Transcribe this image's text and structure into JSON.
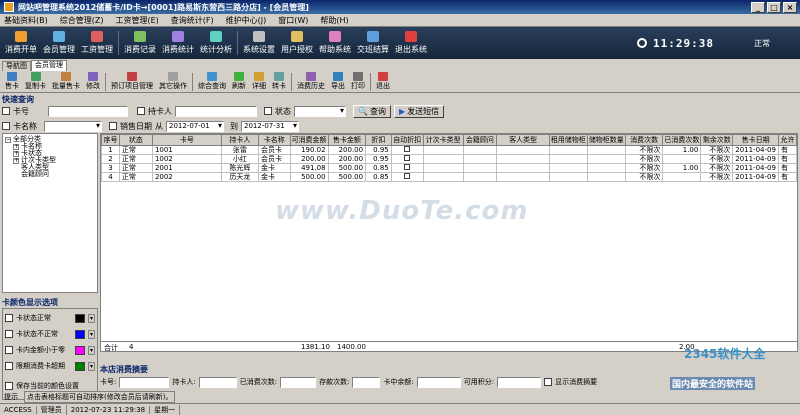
{
  "window": {
    "title": "网站吧管理系统2012储蓄卡/ID卡→[0001]路易斯东营西三路分店] - [会员管理]",
    "buttons": [
      "_",
      "□",
      "×"
    ]
  },
  "menu": [
    "基础资料(B)",
    "综合管理(Z)",
    "工资管理(E)",
    "查询统计(F)",
    "维护中心(J)",
    "窗口(W)",
    "帮助(H)"
  ],
  "main_toolbar": {
    "items": [
      {
        "label": "消费开单",
        "color": "#f0a030"
      },
      {
        "label": "会员管理",
        "color": "#60b0e0"
      },
      {
        "label": "工资管理",
        "color": "#e06060"
      },
      {
        "label": "消费记录",
        "color": "#80c060"
      },
      {
        "label": "消费统计",
        "color": "#a080e0"
      },
      {
        "label": "统计分析",
        "color": "#60d0c0"
      },
      {
        "label": "系统设置",
        "color": "#c0c0c0"
      },
      {
        "label": "用户授权",
        "color": "#e0c060"
      },
      {
        "label": "帮助系统",
        "color": "#e080c0"
      },
      {
        "label": "交班结算",
        "color": "#60a0e0"
      },
      {
        "label": "退出系统",
        "color": "#e04040"
      }
    ],
    "time": "11:29:38",
    "status": "正常"
  },
  "tabs": [
    {
      "label": "导航图",
      "active": false
    },
    {
      "label": "会员管理",
      "active": true
    }
  ],
  "sub_toolbar": {
    "items": [
      "售卡",
      "复制卡",
      "批量售卡",
      "修改",
      "预订项目管理",
      "其它操作",
      "综合查询",
      "刷新",
      "详细",
      "转卡",
      "消费历史",
      "导出",
      "打印",
      "退出"
    ]
  },
  "quick_query": {
    "title": "快速查询",
    "card_no_label": "卡号",
    "holder_label": "持卡人",
    "state_label": "状态",
    "query_button": "查询",
    "sms_button": "发送短信",
    "card_name_label": "卡名称",
    "sell_date_label": "销售日期",
    "from_label": "从",
    "from_date": "2012-07-01",
    "to_label": "到",
    "to_date": "2012-07-31"
  },
  "tree": {
    "root": "全部分类",
    "children": [
      {
        "label": "卡名称",
        "expander": "+"
      },
      {
        "label": "卡状态",
        "expander": "+"
      },
      {
        "label": "计次卡类型",
        "expander": "+"
      },
      {
        "label": "客人类型",
        "expander": ""
      },
      {
        "label": "会籍顾问",
        "expander": ""
      }
    ]
  },
  "color_options": {
    "title": "卡颜色显示选项",
    "rows": [
      {
        "label": "卡状态正常",
        "color": "#000000"
      },
      {
        "label": "卡状态不正常",
        "color": "#0000ff"
      },
      {
        "label": "卡内金额小于零",
        "color": "#ff00ff"
      },
      {
        "label": "限期消费卡超期",
        "color": "#008000"
      }
    ],
    "save_label": "保存当前的颜色设置"
  },
  "grid": {
    "columns": [
      "序号",
      "状态",
      "卡号",
      "持卡人",
      "卡名称",
      "可消费金额",
      "售卡金额",
      "折扣",
      "自动折扣",
      "计次卡类型",
      "会籍顾问",
      "客人类型",
      "租用储物柜",
      "储物柜数量",
      "消费次数",
      "已消费次数",
      "剩余次数",
      "售卡日期",
      "允许"
    ],
    "rows": [
      [
        "1",
        "正常",
        "1001",
        "张雷",
        "会员卡",
        "190.02",
        "200.00",
        "0.95",
        "",
        "",
        "",
        "",
        "",
        "",
        "不限次",
        "1.00",
        "不限次",
        "2011-04-09",
        "有"
      ],
      [
        "2",
        "正常",
        "1002",
        "小红",
        "会员卡",
        "200.00",
        "200.00",
        "0.95",
        "",
        "",
        "",
        "",
        "",
        "",
        "不限次",
        "",
        "不限次",
        "2011-04-09",
        "有"
      ],
      [
        "3",
        "正常",
        "2001",
        "陈光辉",
        "金卡",
        "491.08",
        "500.00",
        "0.85",
        "",
        "",
        "",
        "",
        "",
        "",
        "不限次",
        "1.00",
        "不限次",
        "2011-04-09",
        "有"
      ],
      [
        "4",
        "正常",
        "2002",
        "历天龙",
        "金卡",
        "500.00",
        "500.00",
        "0.85",
        "",
        "",
        "",
        "",
        "",
        "",
        "不限次",
        "",
        "不限次",
        "2011-04-09",
        "有"
      ]
    ],
    "summary": {
      "label": "合计",
      "count": "4",
      "balance": "1381.10",
      "sold": "1400.00",
      "used": "2.00"
    }
  },
  "watermark": "www.DuoTe.com",
  "store_summary": {
    "title": "本店消费摘要",
    "fields": [
      "卡号:",
      "持卡人:",
      "已消费次数:",
      "存款次数:",
      "卡中余额:",
      "可用积分:"
    ],
    "show_label": "显示消费摘要"
  },
  "hint": {
    "label": "提示",
    "text": "点击表格标题可自动排序(修改会员后请刷新)。"
  },
  "statusbar": [
    "ACCESS",
    "管理员",
    "2012-07-23 11:29:38",
    "星期一"
  ],
  "branding": {
    "site": "2345软件大全",
    "tagline": "国内最安全的软件站"
  }
}
